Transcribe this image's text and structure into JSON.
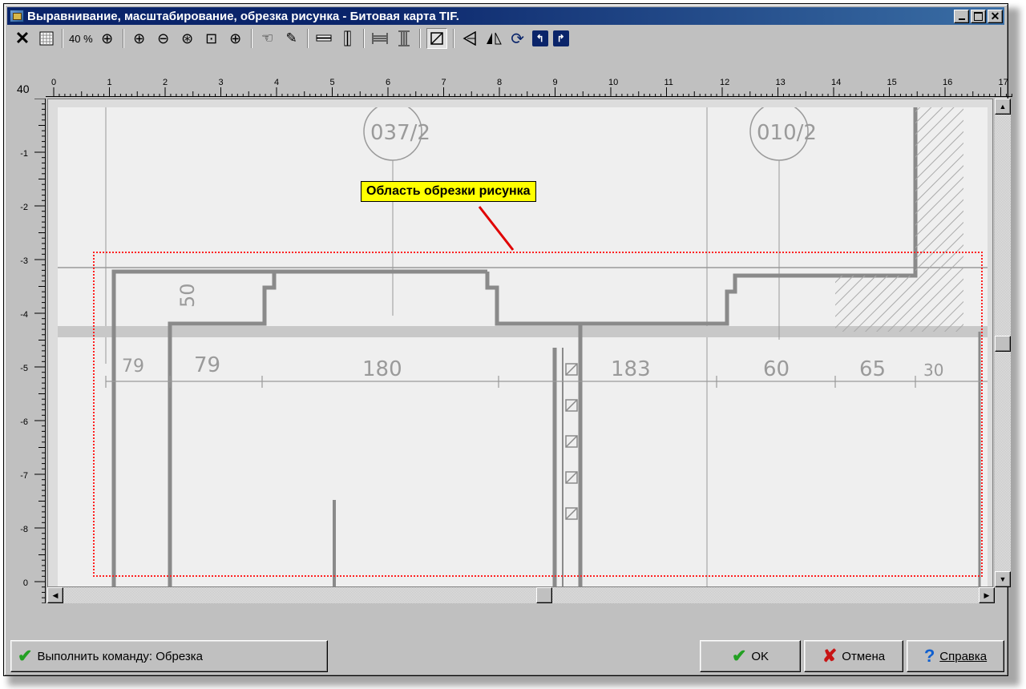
{
  "window": {
    "title": "Выравнивание, масштабирование, обрезка рисунка - Битовая карта TIF."
  },
  "toolbar": {
    "zoom_level": "40 %",
    "icons": [
      "close-x-icon",
      "grid-icon",
      "zoom-in-icon",
      "zoom-in-icon",
      "zoom-out-icon",
      "zoom-fit-icon",
      "zoom-window-icon",
      "zoom-plus-icon",
      "pan-hand-icon",
      "brush-icon",
      "horizontal-align-icon",
      "vertical-align-icon",
      "fit-width-icon",
      "fit-height-icon",
      "crop-icon",
      "skew-icon",
      "mirror-icon",
      "rotate-icon",
      "rotate-left-icon",
      "rotate-right-icon"
    ]
  },
  "rulers": {
    "corner_label": "40",
    "horizontal_labels": [
      "0",
      "1",
      "2",
      "3",
      "4",
      "5",
      "6",
      "7",
      "8",
      "9",
      "10",
      "11",
      "12",
      "13",
      "14",
      "15",
      "16",
      "17"
    ],
    "vertical_labels": [
      "-1",
      "-2",
      "-3",
      "-4",
      "-5",
      "-6",
      "-7",
      "-8",
      "0"
    ]
  },
  "canvas": {
    "callout_label": "Область обрезки рисунка",
    "callout_color": "#ffff00",
    "crop_border_color": "#ff2020",
    "drawing_labels": [
      "037/2",
      "010/2",
      "50",
      "79",
      "180",
      "183",
      "60",
      "65",
      "30",
      "50"
    ]
  },
  "footer": {
    "execute_label": "Выполнить команду: Обрезка",
    "ok_label": "OK",
    "cancel_label": "Отмена",
    "help_label": "Справка"
  }
}
